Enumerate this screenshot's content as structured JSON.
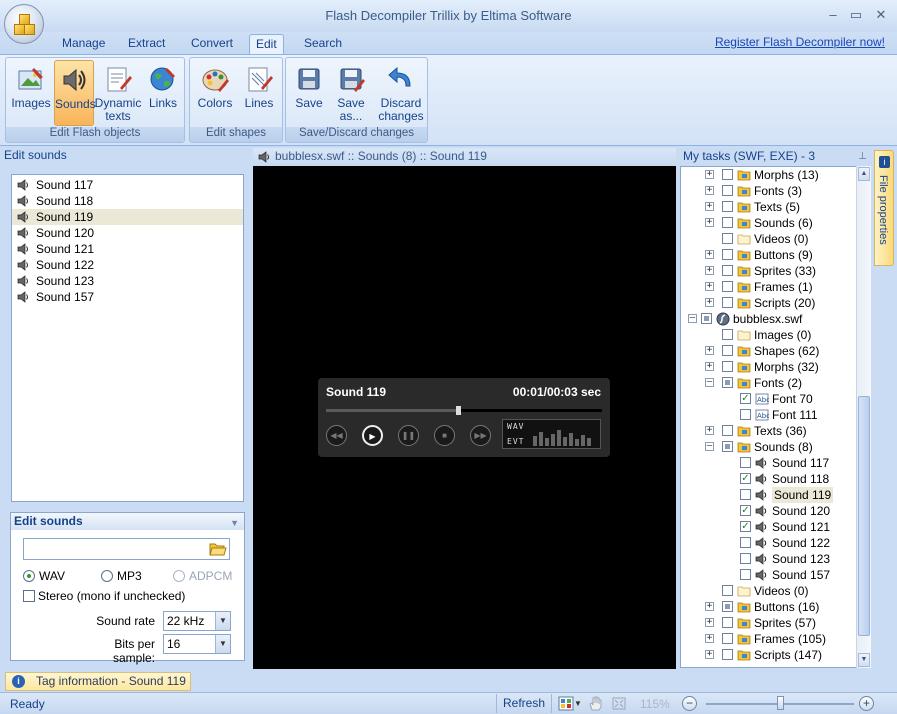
{
  "app": {
    "title": "Flash Decompiler Trillix by Eltima Software"
  },
  "window_controls": {
    "minimize": "–",
    "maximize": "▭",
    "close": "✕"
  },
  "menu": {
    "tabs": [
      "Manage",
      "Extract",
      "Convert",
      "Edit",
      "Search"
    ],
    "active_tab": "Edit",
    "register_link": "Register Flash Decompiler now!"
  },
  "ribbon": {
    "groups": [
      {
        "label": "Edit Flash objects",
        "buttons": [
          "Images",
          "Sounds",
          "Dynamic texts",
          "Links"
        ]
      },
      {
        "label": "Edit shapes",
        "buttons": [
          "Colors",
          "Lines"
        ]
      },
      {
        "label": "Save/Discard changes",
        "buttons": [
          "Save",
          "Save as...",
          "Discard changes"
        ]
      }
    ],
    "active_button": "Sounds"
  },
  "left_panel": {
    "title": "Edit sounds",
    "sounds": [
      "Sound 117",
      "Sound 118",
      "Sound 119",
      "Sound 120",
      "Sound 121",
      "Sound 122",
      "Sound 123",
      "Sound 157"
    ],
    "selected": "Sound 119"
  },
  "props": {
    "title": "Edit sounds",
    "file_value": "",
    "formats": [
      "WAV",
      "MP3",
      "ADPCM"
    ],
    "selected_format": "WAV",
    "disabled_format": "ADPCM",
    "stereo_label": "Stereo (mono if unchecked)",
    "stereo_checked": false,
    "sound_rate_label": "Sound rate",
    "sound_rate_value": "22 kHz",
    "bits_label": "Bits per sample:",
    "bits_value": "16"
  },
  "center": {
    "path": "bubblesx.swf :: Sounds (8) :: Sound 119",
    "player": {
      "title": "Sound 119",
      "time": "00:01/00:03 sec",
      "progress": 0.48,
      "wave_format": "WAV",
      "wave_secondary": "EVT"
    }
  },
  "tree": {
    "title": "My tasks (SWF, EXE) - 3",
    "pin": "⊥",
    "file_properties_tab": "File properties",
    "nodes": [
      {
        "label": "Morphs (13)",
        "level": 1,
        "exp": "+",
        "check": "empty",
        "icon": "folder"
      },
      {
        "label": "Fonts (3)",
        "level": 1,
        "exp": "+",
        "check": "empty",
        "icon": "folder"
      },
      {
        "label": "Texts (5)",
        "level": 1,
        "exp": "+",
        "check": "empty",
        "icon": "folder"
      },
      {
        "label": "Sounds (6)",
        "level": 1,
        "exp": "+",
        "check": "empty",
        "icon": "folder"
      },
      {
        "label": "Videos (0)",
        "level": 1,
        "exp": "",
        "check": "empty",
        "icon": "folder-empty"
      },
      {
        "label": "Buttons (9)",
        "level": 1,
        "exp": "+",
        "check": "empty",
        "icon": "folder"
      },
      {
        "label": "Sprites (33)",
        "level": 1,
        "exp": "+",
        "check": "empty",
        "icon": "folder"
      },
      {
        "label": "Frames (1)",
        "level": 1,
        "exp": "+",
        "check": "empty",
        "icon": "folder"
      },
      {
        "label": "Scripts (20)",
        "level": 1,
        "exp": "+",
        "check": "empty",
        "icon": "folder"
      },
      {
        "label": "bubblesx.swf",
        "level": 0,
        "exp": "–",
        "check": "partial",
        "icon": "swf"
      },
      {
        "label": "Images (0)",
        "level": 1,
        "exp": "",
        "check": "empty",
        "icon": "folder-empty"
      },
      {
        "label": "Shapes (62)",
        "level": 1,
        "exp": "+",
        "check": "empty",
        "icon": "folder"
      },
      {
        "label": "Morphs (32)",
        "level": 1,
        "exp": "+",
        "check": "empty",
        "icon": "folder"
      },
      {
        "label": "Fonts (2)",
        "level": 1,
        "exp": "–",
        "check": "partial",
        "icon": "folder"
      },
      {
        "label": "Font 70",
        "level": 2,
        "exp": "",
        "check": "checked",
        "icon": "font"
      },
      {
        "label": "Font 111",
        "level": 2,
        "exp": "",
        "check": "empty",
        "icon": "font"
      },
      {
        "label": "Texts (36)",
        "level": 1,
        "exp": "+",
        "check": "empty",
        "icon": "folder"
      },
      {
        "label": "Sounds (8)",
        "level": 1,
        "exp": "–",
        "check": "partial",
        "icon": "folder"
      },
      {
        "label": "Sound 117",
        "level": 2,
        "exp": "",
        "check": "empty",
        "icon": "sound"
      },
      {
        "label": "Sound 118",
        "level": 2,
        "exp": "",
        "check": "checked",
        "icon": "sound"
      },
      {
        "label": "Sound 119",
        "level": 2,
        "exp": "",
        "check": "empty",
        "icon": "sound",
        "selected": true
      },
      {
        "label": "Sound 120",
        "level": 2,
        "exp": "",
        "check": "checked",
        "icon": "sound"
      },
      {
        "label": "Sound 121",
        "level": 2,
        "exp": "",
        "check": "checked",
        "icon": "sound"
      },
      {
        "label": "Sound 122",
        "level": 2,
        "exp": "",
        "check": "empty",
        "icon": "sound"
      },
      {
        "label": "Sound 123",
        "level": 2,
        "exp": "",
        "check": "empty",
        "icon": "sound"
      },
      {
        "label": "Sound 157",
        "level": 2,
        "exp": "",
        "check": "empty",
        "icon": "sound"
      },
      {
        "label": "Videos (0)",
        "level": 1,
        "exp": "",
        "check": "empty",
        "icon": "folder-empty"
      },
      {
        "label": "Buttons (16)",
        "level": 1,
        "exp": "+",
        "check": "partial",
        "icon": "folder"
      },
      {
        "label": "Sprites (57)",
        "level": 1,
        "exp": "+",
        "check": "empty",
        "icon": "folder"
      },
      {
        "label": "Frames (105)",
        "level": 1,
        "exp": "+",
        "check": "empty",
        "icon": "folder"
      },
      {
        "label": "Scripts (147)",
        "level": 1,
        "exp": "+",
        "check": "empty",
        "icon": "folder"
      }
    ]
  },
  "tag_info": {
    "text": "Tag information - Sound 119",
    "icon": "info-icon"
  },
  "status": {
    "text": "Ready",
    "refresh": "Refresh",
    "zoom": "115%",
    "zoom_level": 0.5
  },
  "colors": {
    "accent": "#15428b",
    "active_button": "#f9b45a",
    "selection": "#ebe8d8",
    "stage": "#000000"
  }
}
